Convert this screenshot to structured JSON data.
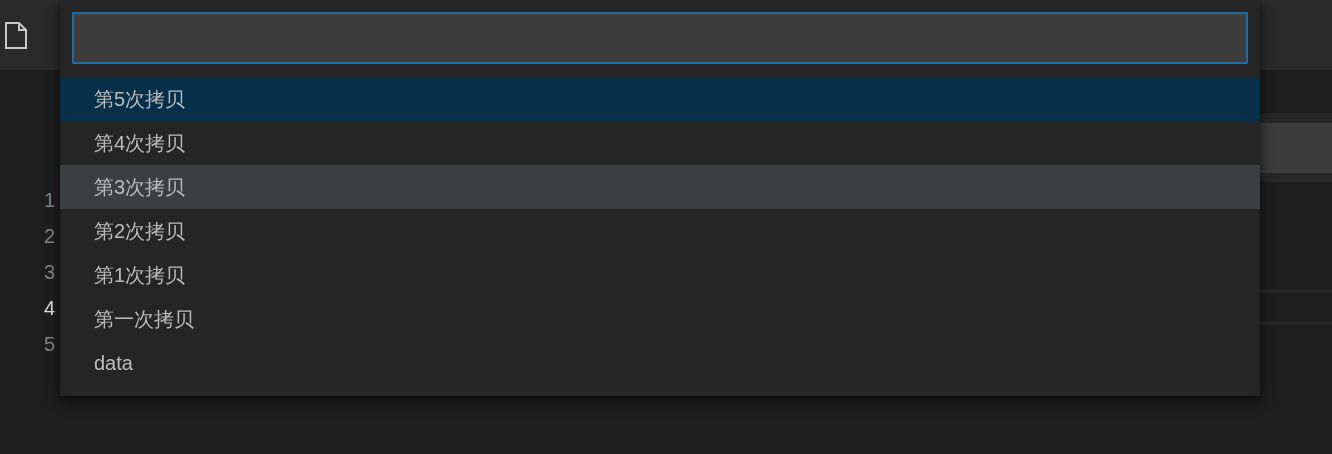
{
  "editor": {
    "line_numbers": [
      {
        "number": "1",
        "current": false
      },
      {
        "number": "2",
        "current": false
      },
      {
        "number": "3",
        "current": false
      },
      {
        "number": "4",
        "current": true
      },
      {
        "number": "5",
        "current": false
      }
    ]
  },
  "quick_pick": {
    "items": [
      {
        "label": "第5次拷贝",
        "selected": true,
        "hovered": false
      },
      {
        "label": "第4次拷贝",
        "selected": false,
        "hovered": false
      },
      {
        "label": "第3次拷贝",
        "selected": false,
        "hovered": true
      },
      {
        "label": "第2次拷贝",
        "selected": false,
        "hovered": false
      },
      {
        "label": "第1次拷贝",
        "selected": false,
        "hovered": false
      },
      {
        "label": "第一次拷贝",
        "selected": false,
        "hovered": false
      },
      {
        "label": "data",
        "selected": false,
        "hovered": false
      }
    ]
  }
}
